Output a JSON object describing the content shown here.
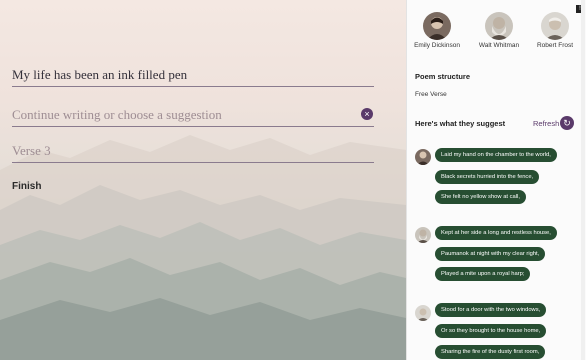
{
  "editor": {
    "line1": "My life has been an ink filled pen",
    "line2_placeholder": "Continue writing or choose a suggestion",
    "line3_placeholder": "Verse 3",
    "finish_label": "Finish",
    "clear_icon": "×"
  },
  "poets": [
    {
      "name": "Emily Dickinson",
      "icon": "emily-dickinson-avatar"
    },
    {
      "name": "Walt Whitman",
      "icon": "walt-whitman-avatar"
    },
    {
      "name": "Robert Frost",
      "icon": "robert-frost-avatar"
    }
  ],
  "badge": "!",
  "structure": {
    "title": "Poem structure",
    "value": "Free Verse"
  },
  "suggestions_header": "Here's what they suggest",
  "refresh_label": "Refresh",
  "refresh_icon": "↻",
  "suggestions": [
    {
      "poet": "Emily Dickinson",
      "lines": [
        "Laid my hand on the chamber to the world,",
        "Black secrets hurried into the fence,",
        "She felt no yellow show at call,"
      ]
    },
    {
      "poet": "Walt Whitman",
      "lines": [
        "Kept at her side a long and restless house,",
        "Paumanok at night with my clear right,",
        "Played a mite upon a royal harp;"
      ]
    },
    {
      "poet": "Robert Frost",
      "lines": [
        "Stood for a door with the two windows,",
        "Or so they brought to the house home,",
        "Sharing the fire of the dusty first room,"
      ]
    }
  ],
  "colors": {
    "accent": "#5a3a6a",
    "pill": "#274e32"
  }
}
